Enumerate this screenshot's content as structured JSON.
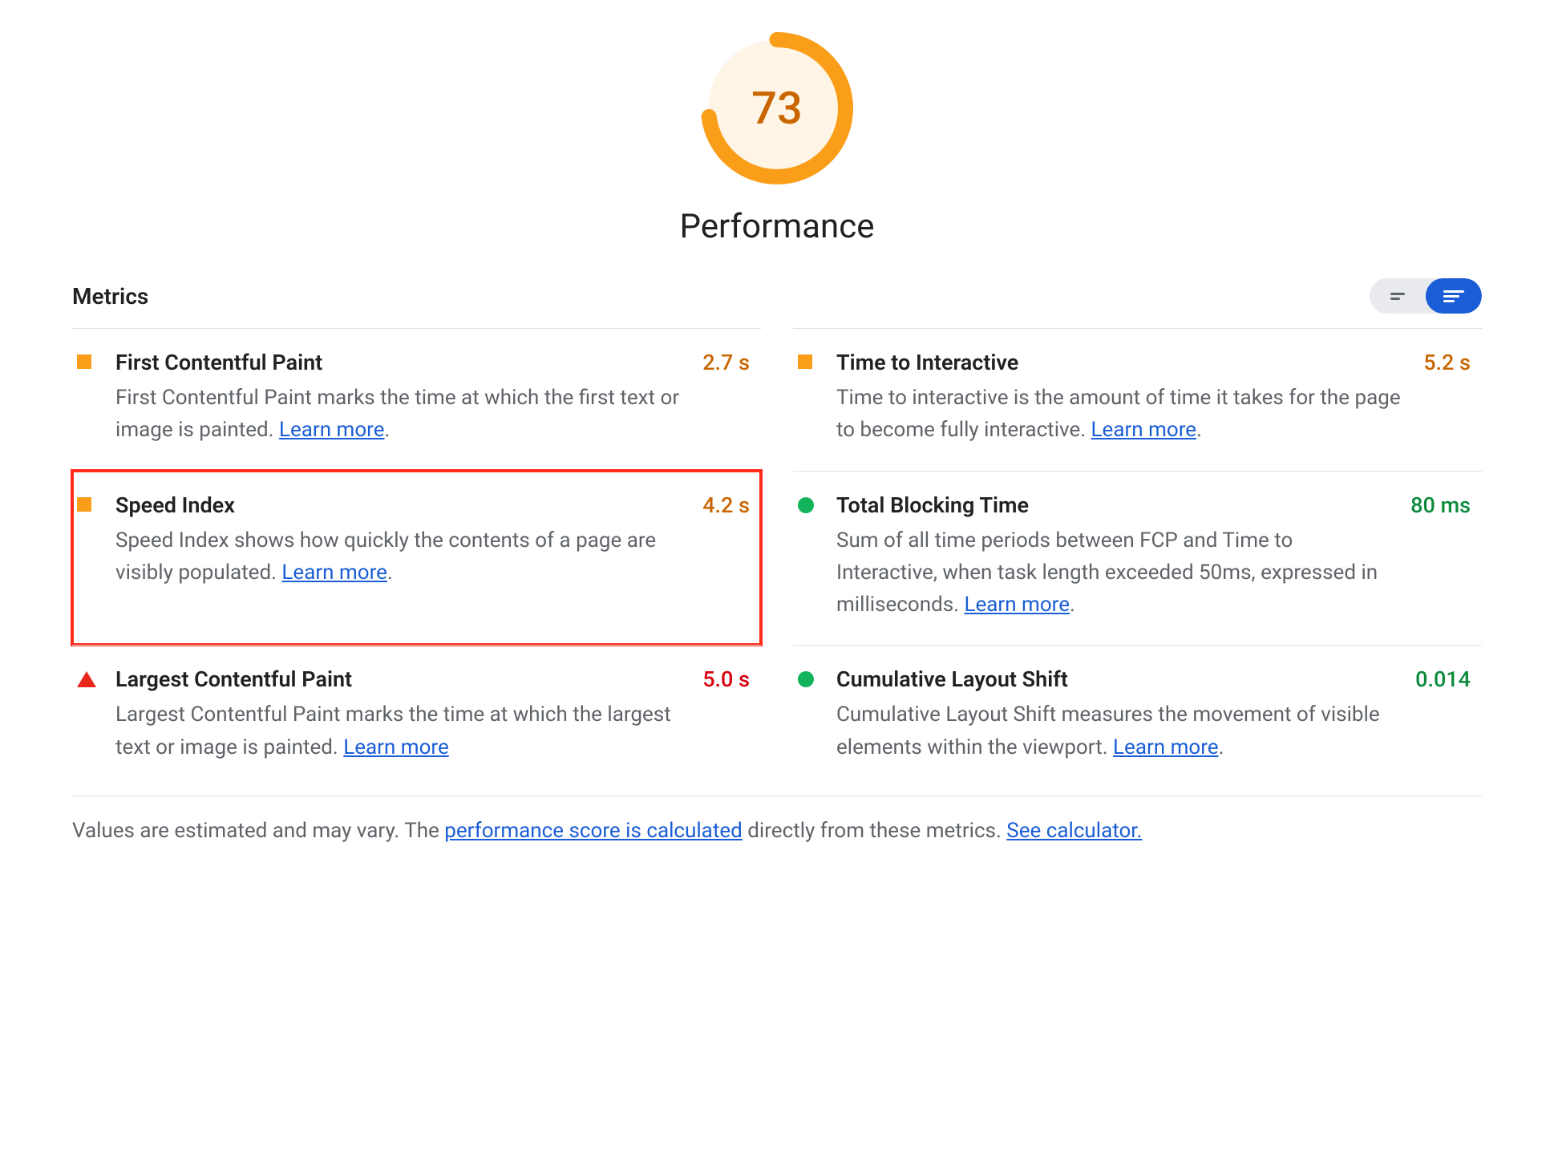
{
  "gauge": {
    "score": "73",
    "title": "Performance",
    "percent": 73,
    "color": "#FA9E19"
  },
  "metrics_header": "Metrics",
  "metrics": [
    {
      "id": "fcp",
      "icon": "square-orange",
      "title": "First Contentful Paint",
      "desc_pre": "First Contentful Paint marks the time at which the first text or image is painted. ",
      "learn": "Learn more",
      "desc_post": ".",
      "value": "2.7 s",
      "value_class": "val-orange",
      "highlight": false
    },
    {
      "id": "tti",
      "icon": "square-orange",
      "title": "Time to Interactive",
      "desc_pre": "Time to interactive is the amount of time it takes for the page to become fully interactive. ",
      "learn": "Learn more",
      "desc_post": ".",
      "value": "5.2 s",
      "value_class": "val-orange",
      "highlight": false
    },
    {
      "id": "si",
      "icon": "square-orange",
      "title": "Speed Index",
      "desc_pre": "Speed Index shows how quickly the contents of a page are visibly populated. ",
      "learn": "Learn more",
      "desc_post": ".",
      "value": "4.2 s",
      "value_class": "val-orange",
      "highlight": true
    },
    {
      "id": "tbt",
      "icon": "circle-green",
      "title": "Total Blocking Time",
      "desc_pre": "Sum of all time periods between FCP and Time to Interactive, when task length exceeded 50ms, expressed in milliseconds. ",
      "learn": "Learn more",
      "desc_post": ".",
      "value": "80 ms",
      "value_class": "val-green",
      "highlight": false
    },
    {
      "id": "lcp",
      "icon": "triangle-red",
      "title": "Largest Contentful Paint",
      "desc_pre": "Largest Contentful Paint marks the time at which the largest text or image is painted. ",
      "learn": "Learn more",
      "desc_post": "",
      "value": "5.0 s",
      "value_class": "val-red",
      "highlight": false
    },
    {
      "id": "cls",
      "icon": "circle-green",
      "title": "Cumulative Layout Shift",
      "desc_pre": "Cumulative Layout Shift measures the movement of visible elements within the viewport. ",
      "learn": "Learn more",
      "desc_post": ".",
      "value": "0.014",
      "value_class": "val-green",
      "highlight": false
    }
  ],
  "footnote": {
    "pre": "Values are estimated and may vary. The ",
    "link1": "performance score is calculated",
    "mid": " directly from these metrics. ",
    "link2": "See calculator."
  }
}
